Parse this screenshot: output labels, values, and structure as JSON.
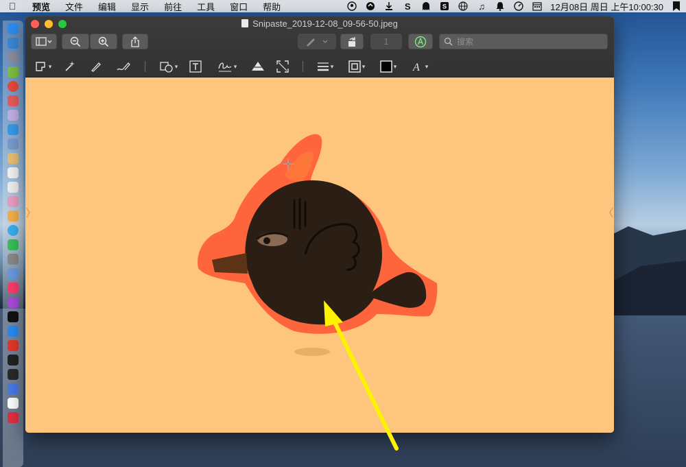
{
  "menubar": {
    "apple_icon": "apple-icon",
    "items": [
      "预览",
      "文件",
      "编辑",
      "显示",
      "前往",
      "工具",
      "窗口",
      "帮助"
    ],
    "status_icons": [
      "github-icon",
      "vpn-icon",
      "download-icon",
      "snipaste-icon",
      "ghost-icon",
      "sogou-icon",
      "globe-icon",
      "music-icon",
      "notification-icon",
      "vpn-gauge-icon",
      "calendar-icon"
    ],
    "clock": "12月08日 周日 上午10:00:30",
    "extra_icon": "bookmark-icon"
  },
  "window": {
    "title": "Snipaste_2019-12-08_09-56-50.jpeg",
    "page_number": "1",
    "search_placeholder": "搜索"
  },
  "toolbar": {
    "sidebar_toggle": "sidebar-icon",
    "zoom_out": "zoom-out-icon",
    "zoom_in": "zoom-in-icon",
    "share": "share-icon",
    "pen": "pen-icon",
    "rotate": "rotate-icon",
    "markup": "markup-icon"
  },
  "markup_tools": [
    "selection-tool",
    "instant-alpha-tool",
    "sketch-tool",
    "draw-tool",
    "shapes-tool",
    "text-tool",
    "sign-tool",
    "adjust-color-tool",
    "adjust-size-tool",
    "line-style-tool",
    "border-color-tool",
    "fill-color-tool",
    "text-style-tool"
  ],
  "colors": {
    "canvas": "#fdc57e",
    "fish_body": "#2b1e14",
    "highlight": "#ff4a2a",
    "arrow": "#fff200"
  },
  "dock": {
    "icons": [
      "finder-icon",
      "safari-icon",
      "rocket-icon",
      "android-icon",
      "chrome-icon",
      "app-icon",
      "app-icon",
      "safari-icon",
      "preview-icon",
      "notes-icon",
      "calendar-icon",
      "reminders-icon",
      "photos-icon",
      "photos-icon",
      "messages-icon",
      "wechat-icon",
      "settings-icon",
      "keynote-icon",
      "music-icon",
      "podcasts-icon",
      "tv-icon",
      "appstore-icon",
      "vivaldi-icon",
      "terminal-icon",
      "activity-icon",
      "vpn-icon",
      "yandex-icon",
      "netease-icon"
    ]
  }
}
